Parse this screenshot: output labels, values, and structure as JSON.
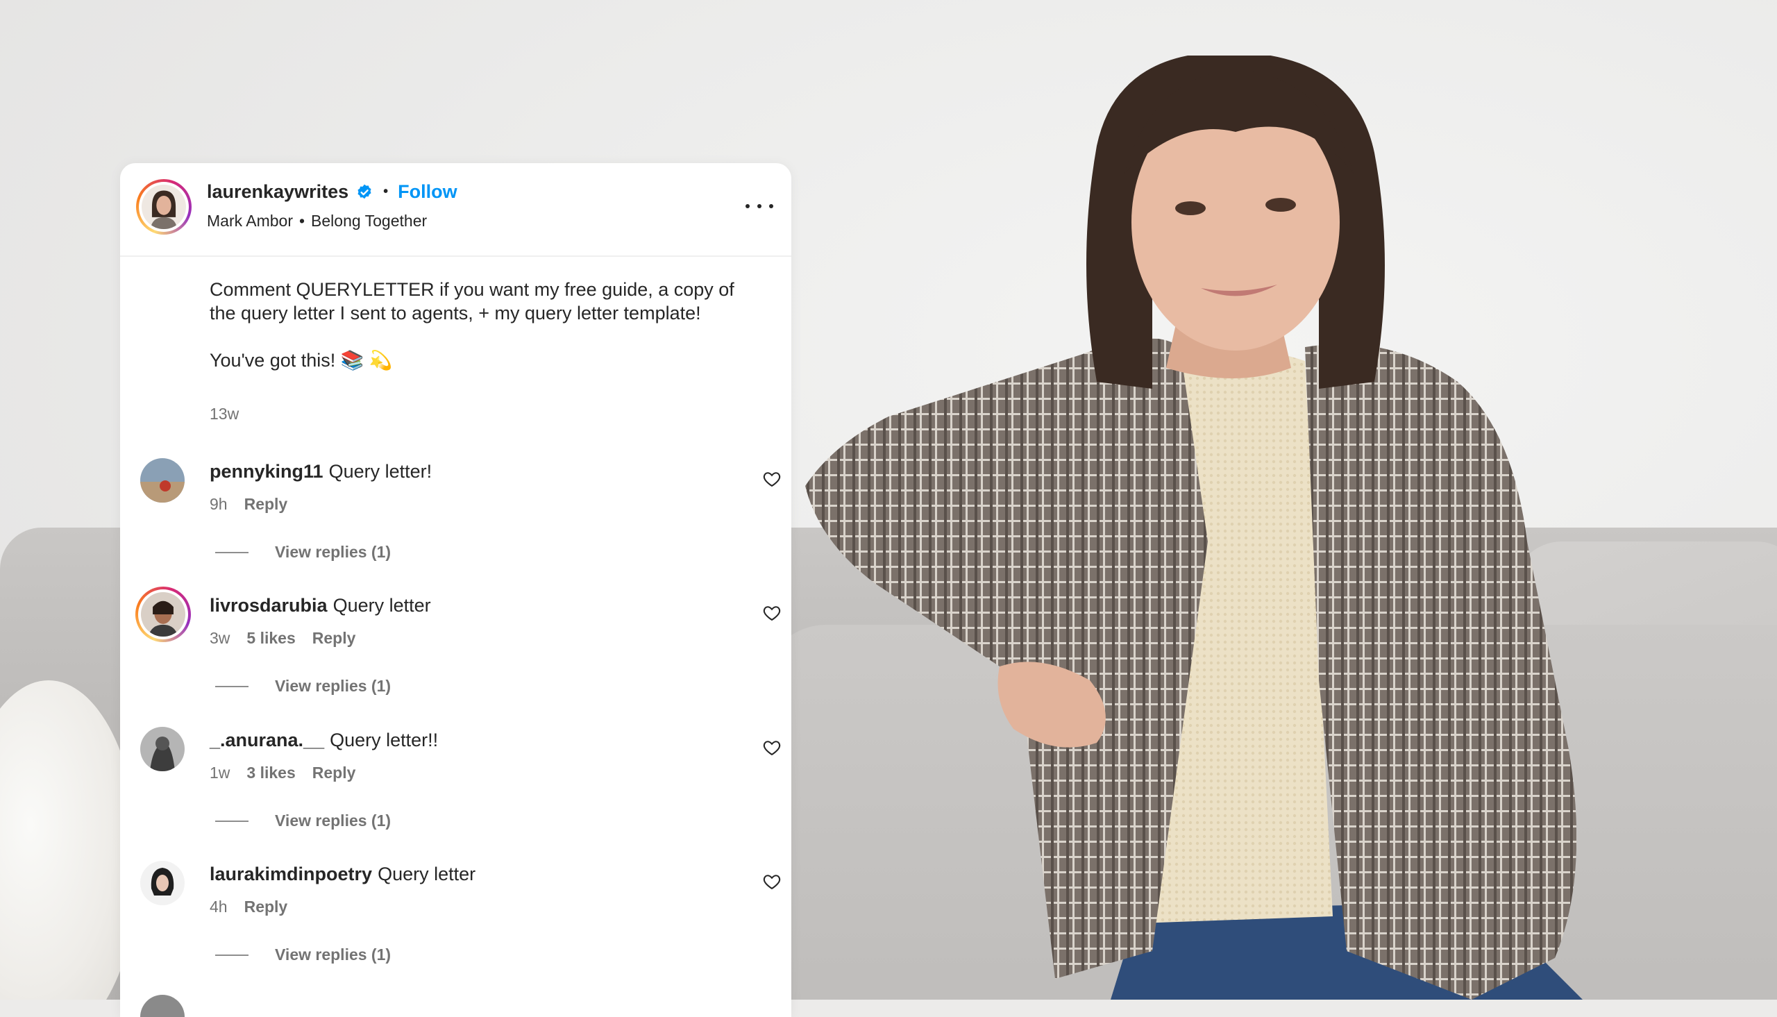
{
  "post": {
    "username": "laurenkaywrites",
    "follow_label": "Follow",
    "separator": "•",
    "music_artist": "Mark Ambor",
    "music_title": "Belong Together",
    "caption_line1": "Comment QUERYLETTER if you want my free guide, a copy of the query letter I sent to agents, + my query letter template!",
    "caption_line2": "You've got this! 📚 💫",
    "time": "13w"
  },
  "comments": [
    {
      "username": "pennyking11",
      "text": "Query letter!",
      "time": "9h",
      "likes": "",
      "reply_label": "Reply",
      "view_replies": "View replies (1)",
      "has_story_ring": false
    },
    {
      "username": "livrosdarubia",
      "text": "Query letter",
      "time": "3w",
      "likes": "5 likes",
      "reply_label": "Reply",
      "view_replies": "View replies (1)",
      "has_story_ring": true
    },
    {
      "username": "_.anurana.__",
      "text": "Query letter!!",
      "time": "1w",
      "likes": "3 likes",
      "reply_label": "Reply",
      "view_replies": "View replies (1)",
      "has_story_ring": false
    },
    {
      "username": "laurakimdinpoetry",
      "text": "Query letter",
      "time": "4h",
      "likes": "",
      "reply_label": "Reply",
      "view_replies": "View replies (1)",
      "has_story_ring": false
    }
  ],
  "icons": {
    "verified": "verified-badge-icon",
    "more": "more-options-icon",
    "like": "heart-icon"
  },
  "colors": {
    "link_blue": "#0095f6",
    "verified_blue": "#0095f6",
    "text_primary": "#262626",
    "text_secondary": "#737373"
  }
}
